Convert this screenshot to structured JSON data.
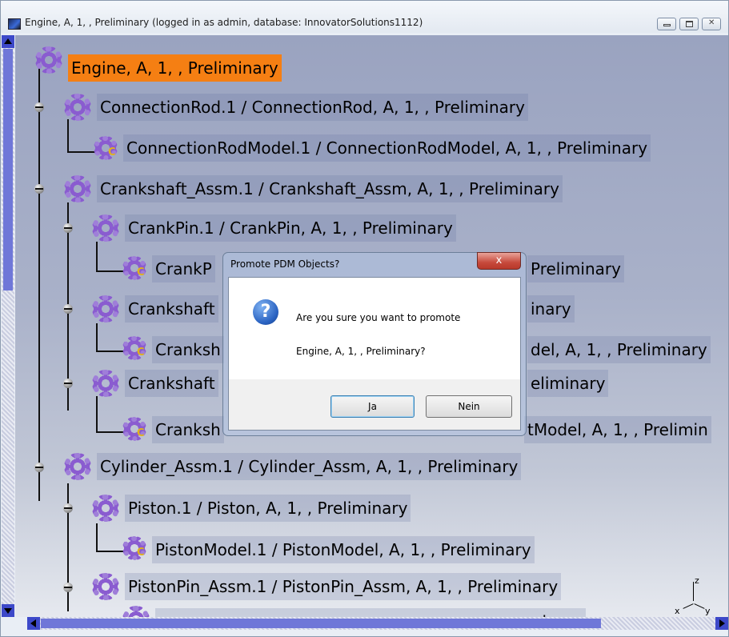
{
  "window": {
    "title": "Engine, A, 1, , Preliminary (logged in as admin, database: InnovatorSolutions1112)",
    "controls": [
      "minimize",
      "maximize",
      "close"
    ]
  },
  "tree": {
    "nodes": [
      {
        "label": "Engine, A, 1, , Preliminary",
        "icon": "assembly-gear-icon",
        "selected": true
      },
      {
        "label": "ConnectionRod.1 / ConnectionRod, A, 1, , Preliminary",
        "icon": "assembly-gear-icon"
      },
      {
        "label": "ConnectionRodModel.1 / ConnectionRodModel, A, 1, , Preliminary",
        "icon": "part-gear-icon"
      },
      {
        "label": "Crankshaft_Assm.1 / Crankshaft_Assm, A, 1, , Preliminary",
        "icon": "assembly-gear-icon"
      },
      {
        "label": "CrankPin.1 / CrankPin, A, 1, , Preliminary",
        "icon": "assembly-gear-icon"
      },
      {
        "label": "CrankP",
        "label_right": "Preliminary",
        "icon": "part-gear-icon"
      },
      {
        "label": "Crankshaft",
        "label_right": "inary",
        "icon": "assembly-gear-icon"
      },
      {
        "label": "Cranksh",
        "label_right": "del, A, 1, , Preliminary",
        "icon": "part-gear-icon"
      },
      {
        "label": "Crankshaft",
        "label_right": "eliminary",
        "icon": "assembly-gear-icon"
      },
      {
        "label": "Cranksh",
        "label_right": "tModel, A, 1, , Prelimin",
        "icon": "part-gear-icon"
      },
      {
        "label": "Cylinder_Assm.1 / Cylinder_Assm, A, 1, , Preliminary",
        "icon": "assembly-gear-icon"
      },
      {
        "label": "Piston.1 / Piston, A, 1, , Preliminary",
        "icon": "assembly-gear-icon"
      },
      {
        "label": "PistonModel.1 / PistonModel, A, 1, , Preliminary",
        "icon": "part-gear-icon"
      },
      {
        "label": "PistonPin_Assm.1 / PistonPin_Assm, A, 1, , Preliminary",
        "icon": "assembly-gear-icon"
      },
      {
        "label": "",
        "label_right": "ninary",
        "icon": "assembly-gear-icon"
      }
    ]
  },
  "compass": {
    "z": "z",
    "x": "x",
    "y": "y"
  },
  "dialog": {
    "title": "Promote PDM Objects?",
    "close_label": "x",
    "message_line1": "Are you sure you want to promote",
    "message_line2": "Engine, A, 1, , Preliminary?",
    "yes_label": "Ja",
    "no_label": "Nein",
    "icon": "question-icon"
  },
  "colors": {
    "selection": "#f57f13",
    "scrollbar": "#3d49c9",
    "gear": "#9f7ed9"
  }
}
